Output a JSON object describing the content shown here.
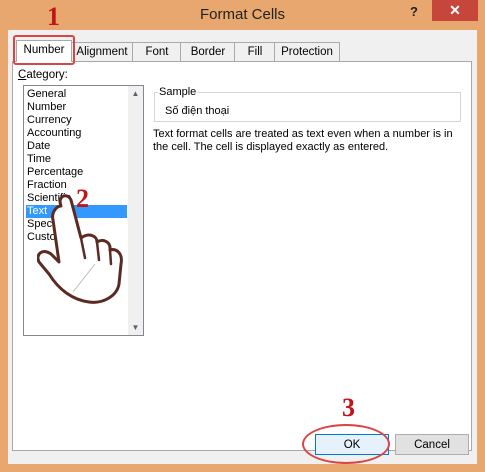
{
  "window": {
    "title": "Format Cells",
    "help_label": "?",
    "close_label": "✕"
  },
  "tabs": [
    {
      "label": "Number",
      "active": true
    },
    {
      "label": "Alignment",
      "active": false
    },
    {
      "label": "Font",
      "active": false
    },
    {
      "label": "Border",
      "active": false
    },
    {
      "label": "Fill",
      "active": false
    },
    {
      "label": "Protection",
      "active": false
    }
  ],
  "category": {
    "label_underlined": "C",
    "label_rest": "ategory:",
    "items": [
      "General",
      "Number",
      "Currency",
      "Accounting",
      "Date",
      "Time",
      "Percentage",
      "Fraction",
      "Scientific",
      "Text",
      "Special",
      "Custom"
    ],
    "selected": "Text",
    "visible_partial": {
      "Special": "Spec",
      "Custom": "Custo"
    }
  },
  "sample": {
    "legend": "Sample",
    "value": "Số điện thoại"
  },
  "description": "Text format cells are treated as text even when a number is in the cell.  The cell is displayed exactly as entered.",
  "buttons": {
    "ok": "OK",
    "cancel": "Cancel"
  },
  "annotations": {
    "step1": "1",
    "step2": "2",
    "step3": "3",
    "color": "#c0141a",
    "hand_watermark": "http://..."
  },
  "colors": {
    "frame": "#e8a76f",
    "close": "#c7463b",
    "selection": "#3399ff"
  }
}
